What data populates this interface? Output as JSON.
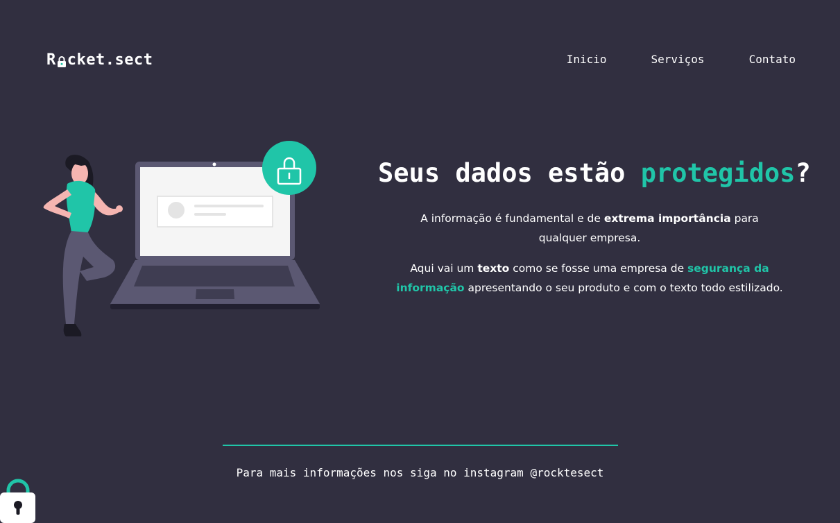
{
  "header": {
    "logo_prefix": "R",
    "logo_suffix": "cket.sect",
    "nav": [
      {
        "label": "Inicio"
      },
      {
        "label": "Serviços"
      },
      {
        "label": "Contato"
      }
    ]
  },
  "hero": {
    "title_part1": "Seus dados estão ",
    "title_accent": "protegidos",
    "title_part2": "?",
    "p1": {
      "t1": "A informação é fundamental e de ",
      "b1": "extrema importância",
      "t2": " para qualquer empresa."
    },
    "p2": {
      "t1": "Aqui vai um ",
      "b1": "texto",
      "t2": " como se fosse uma empresa de ",
      "accent": "segurança da informação",
      "t3": " apresentando o seu produto e com o texto todo estilizado."
    }
  },
  "footer": {
    "text": "Para mais informações nos siga no instagram @rocktesect"
  },
  "colors": {
    "background": "#312f40",
    "accent": "#20c5a8",
    "text": "#ffffff"
  },
  "icons": {
    "logo": "lock-icon",
    "badge": "lock-icon",
    "corner": "lock-icon"
  }
}
